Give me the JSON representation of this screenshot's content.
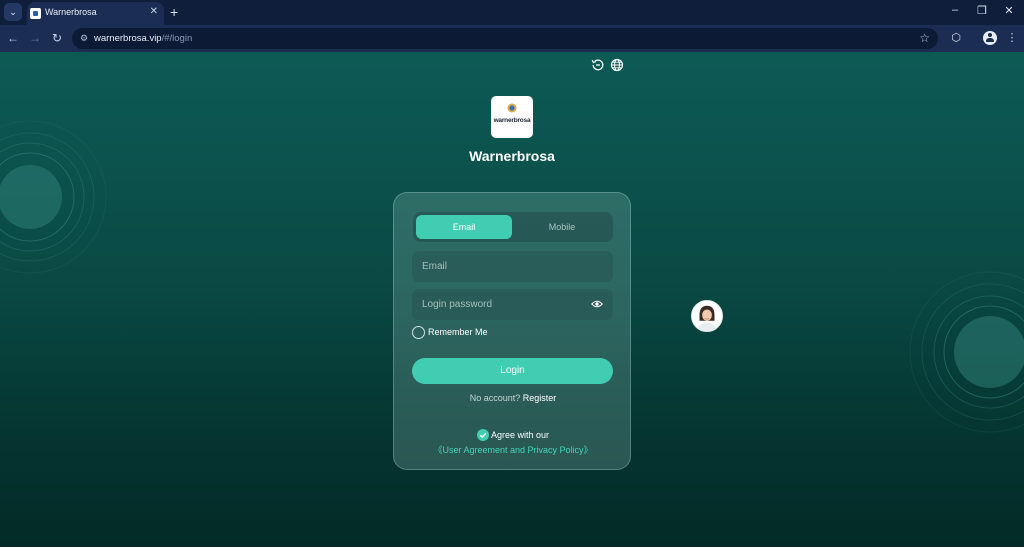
{
  "browser": {
    "tab_title": "Warnerbrosa",
    "tab_close": "✕",
    "new_tab": "+",
    "url_host": "warnerbrosa.vip",
    "url_path": "/#/login",
    "window_controls": [
      "–",
      "❐",
      "✕"
    ]
  },
  "header": {
    "logo_text": "warnerbrosa",
    "brand_name": "Warnerbrosa"
  },
  "login": {
    "tabs": {
      "active": "Email",
      "inactive": "Mobile"
    },
    "email_placeholder": "Email",
    "password_placeholder": "Login password",
    "remember_label": "Remember Me",
    "login_button": "Login",
    "no_account_text": "No account?",
    "register_link": "Register",
    "agree_text": "Agree with our",
    "policy_link": "《User Agreement and Privacy Policy》"
  },
  "colors": {
    "accent": "#40cdb2",
    "page_top": "#0d5a55",
    "page_bottom": "#032a27",
    "chrome": "#1b2d52"
  },
  "icons": {
    "top_bar": [
      "history-icon",
      "globe-icon"
    ],
    "password": "eye-icon",
    "agree": "check-circle-icon",
    "support": "customer-service-avatar"
  }
}
